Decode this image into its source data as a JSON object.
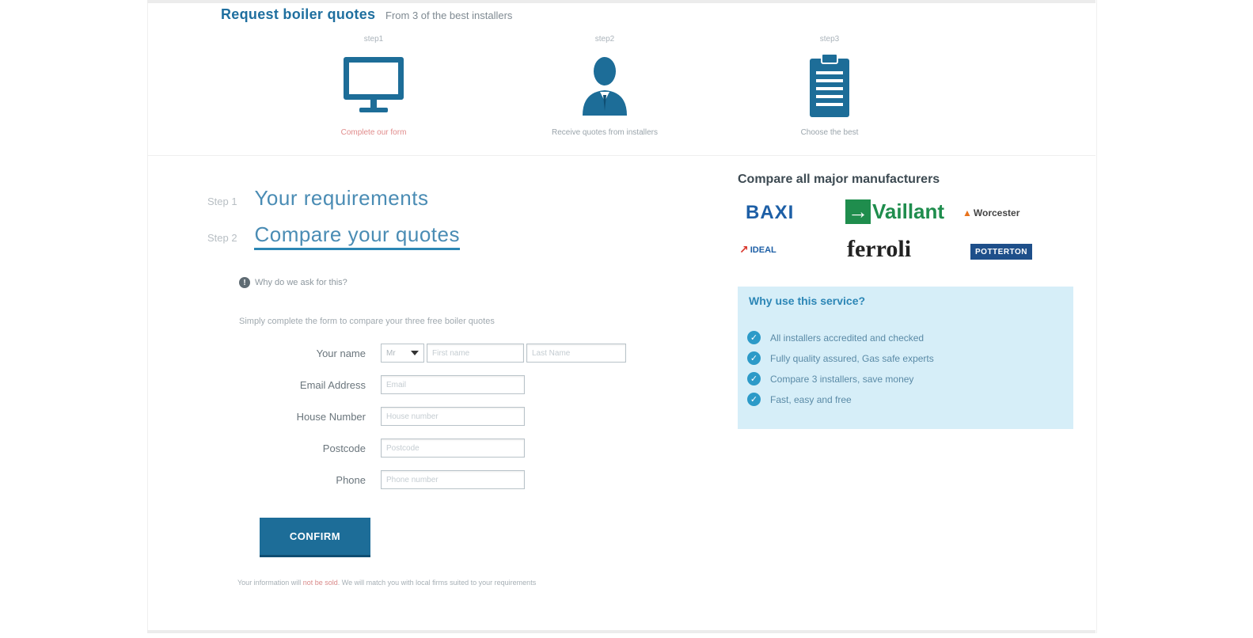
{
  "header": {
    "title": "Request boiler quotes",
    "subtitle": "From 3 of the best installers"
  },
  "steps": [
    {
      "label": "step1",
      "caption": "Complete our form",
      "icon": "monitor-icon"
    },
    {
      "label": "step2",
      "caption": "Receive quotes from installers",
      "icon": "person-icon"
    },
    {
      "label": "step3",
      "caption": "Choose the best",
      "icon": "clipboard-icon"
    }
  ],
  "form_steps": {
    "step1": {
      "num": "Step 1",
      "title": "Your requirements"
    },
    "step2": {
      "num": "Step 2",
      "title": "Compare your quotes"
    }
  },
  "form": {
    "why_link": "Why do we ask for this?",
    "intro": "Simply complete the form to compare your three free boiler quotes",
    "labels": {
      "name": "Your name",
      "email": "Email Address",
      "house": "House Number",
      "postcode": "Postcode",
      "phone": "Phone"
    },
    "title_select": "Mr",
    "placeholders": {
      "first_name": "First name",
      "last_name": "Last Name",
      "email": "Email",
      "house": "House number",
      "postcode": "Postcode",
      "phone": "Phone number"
    },
    "confirm_label": "CONFIRM",
    "disclaimer_prefix": "Your information will ",
    "disclaimer_link": "not be sold",
    "disclaimer_suffix": ". We will match you with local firms suited to your requirements"
  },
  "manufacturers": {
    "title": "Compare all major manufacturers",
    "logos": [
      "BAXI",
      "Vaillant",
      "Worcester",
      "IDEAL",
      "ferroli",
      "POTTERTON"
    ]
  },
  "why_service": {
    "title": "Why use this service?",
    "items": [
      "All installers accredited and checked",
      "Fully quality assured, Gas safe experts",
      "Compare 3 installers, save money",
      "Fast, easy and free"
    ]
  },
  "colors": {
    "accent": "#1d6d98",
    "heading": "#4a8cb4",
    "why_box_bg": "#d6eef8"
  }
}
